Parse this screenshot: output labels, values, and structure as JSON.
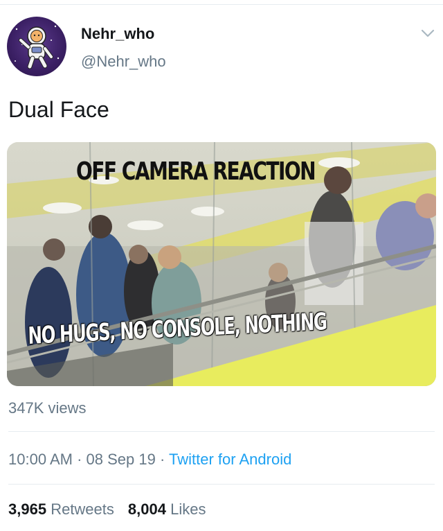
{
  "tweet": {
    "author": {
      "display_name": "Nehr_who",
      "handle": "@Nehr_who",
      "avatar_icon": "astronaut-icon"
    },
    "text": "Dual Face",
    "media": {
      "caption_top": "OFF CAMERA REACTION",
      "caption_bottom": "NO HUGS, NO CONSOLE, NOTHING"
    },
    "views": "347K views",
    "time": "10:00 AM",
    "separator": "·",
    "date": "08 Sep 19",
    "source": "Twitter for Android",
    "retweets_count": "3,965",
    "retweets_label": "Retweets",
    "likes_count": "8,004",
    "likes_label": "Likes"
  },
  "colors": {
    "secondary_text": "#657786",
    "link": "#1da1f2",
    "primary_text": "#14171a",
    "divider": "#e6ecf0"
  }
}
